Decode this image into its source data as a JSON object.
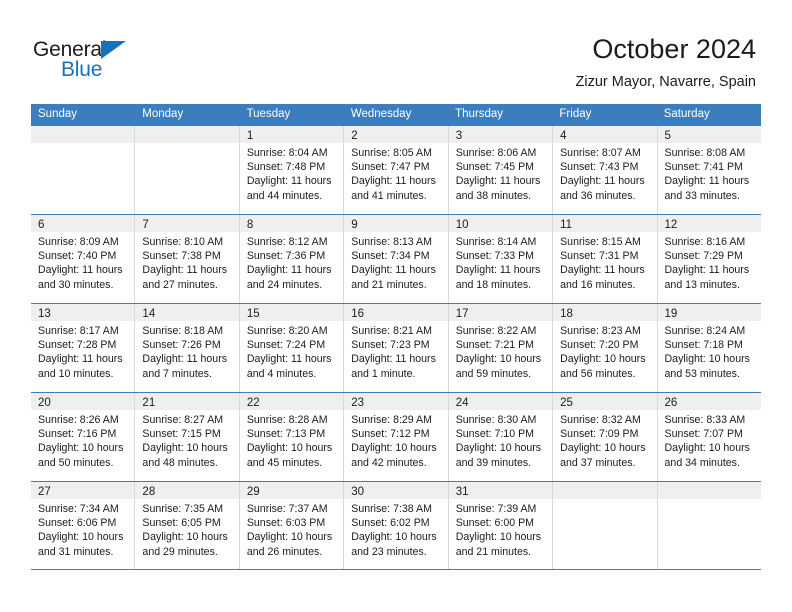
{
  "brand": {
    "name_part1": "General",
    "name_part2": "Blue",
    "accent_color": "#1573bd"
  },
  "header": {
    "title": "October 2024",
    "subtitle": "Zizur Mayor, Navarre, Spain"
  },
  "theme": {
    "header_blue": "#3c7ebd",
    "daynum_bg": "#efefef",
    "cell_border": "#d9d9d9"
  },
  "weekday_headers": [
    "Sunday",
    "Monday",
    "Tuesday",
    "Wednesday",
    "Thursday",
    "Friday",
    "Saturday"
  ],
  "weeks": [
    [
      {
        "day": "",
        "sunrise": "",
        "sunset": "",
        "daylight": "",
        "empty": true
      },
      {
        "day": "",
        "sunrise": "",
        "sunset": "",
        "daylight": "",
        "empty": true
      },
      {
        "day": "1",
        "sunrise": "Sunrise: 8:04 AM",
        "sunset": "Sunset: 7:48 PM",
        "daylight": "Daylight: 11 hours and 44 minutes."
      },
      {
        "day": "2",
        "sunrise": "Sunrise: 8:05 AM",
        "sunset": "Sunset: 7:47 PM",
        "daylight": "Daylight: 11 hours and 41 minutes."
      },
      {
        "day": "3",
        "sunrise": "Sunrise: 8:06 AM",
        "sunset": "Sunset: 7:45 PM",
        "daylight": "Daylight: 11 hours and 38 minutes."
      },
      {
        "day": "4",
        "sunrise": "Sunrise: 8:07 AM",
        "sunset": "Sunset: 7:43 PM",
        "daylight": "Daylight: 11 hours and 36 minutes."
      },
      {
        "day": "5",
        "sunrise": "Sunrise: 8:08 AM",
        "sunset": "Sunset: 7:41 PM",
        "daylight": "Daylight: 11 hours and 33 minutes."
      }
    ],
    [
      {
        "day": "6",
        "sunrise": "Sunrise: 8:09 AM",
        "sunset": "Sunset: 7:40 PM",
        "daylight": "Daylight: 11 hours and 30 minutes."
      },
      {
        "day": "7",
        "sunrise": "Sunrise: 8:10 AM",
        "sunset": "Sunset: 7:38 PM",
        "daylight": "Daylight: 11 hours and 27 minutes."
      },
      {
        "day": "8",
        "sunrise": "Sunrise: 8:12 AM",
        "sunset": "Sunset: 7:36 PM",
        "daylight": "Daylight: 11 hours and 24 minutes."
      },
      {
        "day": "9",
        "sunrise": "Sunrise: 8:13 AM",
        "sunset": "Sunset: 7:34 PM",
        "daylight": "Daylight: 11 hours and 21 minutes."
      },
      {
        "day": "10",
        "sunrise": "Sunrise: 8:14 AM",
        "sunset": "Sunset: 7:33 PM",
        "daylight": "Daylight: 11 hours and 18 minutes."
      },
      {
        "day": "11",
        "sunrise": "Sunrise: 8:15 AM",
        "sunset": "Sunset: 7:31 PM",
        "daylight": "Daylight: 11 hours and 16 minutes."
      },
      {
        "day": "12",
        "sunrise": "Sunrise: 8:16 AM",
        "sunset": "Sunset: 7:29 PM",
        "daylight": "Daylight: 11 hours and 13 minutes."
      }
    ],
    [
      {
        "day": "13",
        "sunrise": "Sunrise: 8:17 AM",
        "sunset": "Sunset: 7:28 PM",
        "daylight": "Daylight: 11 hours and 10 minutes."
      },
      {
        "day": "14",
        "sunrise": "Sunrise: 8:18 AM",
        "sunset": "Sunset: 7:26 PM",
        "daylight": "Daylight: 11 hours and 7 minutes."
      },
      {
        "day": "15",
        "sunrise": "Sunrise: 8:20 AM",
        "sunset": "Sunset: 7:24 PM",
        "daylight": "Daylight: 11 hours and 4 minutes."
      },
      {
        "day": "16",
        "sunrise": "Sunrise: 8:21 AM",
        "sunset": "Sunset: 7:23 PM",
        "daylight": "Daylight: 11 hours and 1 minute."
      },
      {
        "day": "17",
        "sunrise": "Sunrise: 8:22 AM",
        "sunset": "Sunset: 7:21 PM",
        "daylight": "Daylight: 10 hours and 59 minutes."
      },
      {
        "day": "18",
        "sunrise": "Sunrise: 8:23 AM",
        "sunset": "Sunset: 7:20 PM",
        "daylight": "Daylight: 10 hours and 56 minutes."
      },
      {
        "day": "19",
        "sunrise": "Sunrise: 8:24 AM",
        "sunset": "Sunset: 7:18 PM",
        "daylight": "Daylight: 10 hours and 53 minutes."
      }
    ],
    [
      {
        "day": "20",
        "sunrise": "Sunrise: 8:26 AM",
        "sunset": "Sunset: 7:16 PM",
        "daylight": "Daylight: 10 hours and 50 minutes."
      },
      {
        "day": "21",
        "sunrise": "Sunrise: 8:27 AM",
        "sunset": "Sunset: 7:15 PM",
        "daylight": "Daylight: 10 hours and 48 minutes."
      },
      {
        "day": "22",
        "sunrise": "Sunrise: 8:28 AM",
        "sunset": "Sunset: 7:13 PM",
        "daylight": "Daylight: 10 hours and 45 minutes."
      },
      {
        "day": "23",
        "sunrise": "Sunrise: 8:29 AM",
        "sunset": "Sunset: 7:12 PM",
        "daylight": "Daylight: 10 hours and 42 minutes."
      },
      {
        "day": "24",
        "sunrise": "Sunrise: 8:30 AM",
        "sunset": "Sunset: 7:10 PM",
        "daylight": "Daylight: 10 hours and 39 minutes."
      },
      {
        "day": "25",
        "sunrise": "Sunrise: 8:32 AM",
        "sunset": "Sunset: 7:09 PM",
        "daylight": "Daylight: 10 hours and 37 minutes."
      },
      {
        "day": "26",
        "sunrise": "Sunrise: 8:33 AM",
        "sunset": "Sunset: 7:07 PM",
        "daylight": "Daylight: 10 hours and 34 minutes."
      }
    ],
    [
      {
        "day": "27",
        "sunrise": "Sunrise: 7:34 AM",
        "sunset": "Sunset: 6:06 PM",
        "daylight": "Daylight: 10 hours and 31 minutes."
      },
      {
        "day": "28",
        "sunrise": "Sunrise: 7:35 AM",
        "sunset": "Sunset: 6:05 PM",
        "daylight": "Daylight: 10 hours and 29 minutes."
      },
      {
        "day": "29",
        "sunrise": "Sunrise: 7:37 AM",
        "sunset": "Sunset: 6:03 PM",
        "daylight": "Daylight: 10 hours and 26 minutes."
      },
      {
        "day": "30",
        "sunrise": "Sunrise: 7:38 AM",
        "sunset": "Sunset: 6:02 PM",
        "daylight": "Daylight: 10 hours and 23 minutes."
      },
      {
        "day": "31",
        "sunrise": "Sunrise: 7:39 AM",
        "sunset": "Sunset: 6:00 PM",
        "daylight": "Daylight: 10 hours and 21 minutes."
      },
      {
        "day": "",
        "sunrise": "",
        "sunset": "",
        "daylight": "",
        "empty": true
      },
      {
        "day": "",
        "sunrise": "",
        "sunset": "",
        "daylight": "",
        "empty": true
      }
    ]
  ]
}
